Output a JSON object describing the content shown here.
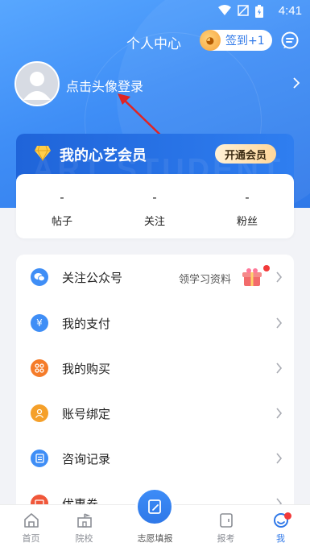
{
  "status_bar": {
    "time": "4:41"
  },
  "header": {
    "title": "个人中心",
    "checkin_label": "签到+1"
  },
  "profile": {
    "login_text": "点击头像登录"
  },
  "vip": {
    "title": "我的心艺会员",
    "button": "开通会员",
    "watermark": "ART STUDENT"
  },
  "stats": [
    {
      "value": "-",
      "label": "帖子"
    },
    {
      "value": "-",
      "label": "关注"
    },
    {
      "value": "-",
      "label": "粉丝"
    }
  ],
  "menu": [
    {
      "label": "关注公众号",
      "extra": "领学习资料",
      "icon": "wechat-icon",
      "color": "#3f8ef6"
    },
    {
      "label": "我的支付",
      "icon": "yen-icon",
      "color": "#3f8ef6"
    },
    {
      "label": "我的购买",
      "icon": "cart-icon",
      "color": "#f57c2a"
    },
    {
      "label": "账号绑定",
      "icon": "user-bind-icon",
      "color": "#f5a02a"
    },
    {
      "label": "咨询记录",
      "icon": "record-icon",
      "color": "#3f8ef6"
    },
    {
      "label": "优惠券",
      "icon": "coupon-icon",
      "color": "#f0573a"
    }
  ],
  "tabbar": [
    {
      "label": "首页",
      "icon": "home-icon"
    },
    {
      "label": "院校",
      "icon": "school-icon"
    },
    {
      "label": "志愿填报",
      "icon": "apply-icon"
    },
    {
      "label": "报考",
      "icon": "exam-icon"
    },
    {
      "label": "我",
      "icon": "me-icon",
      "active": true
    }
  ],
  "colors": {
    "primary": "#2f78e8",
    "accent_red": "#f23a3a"
  }
}
